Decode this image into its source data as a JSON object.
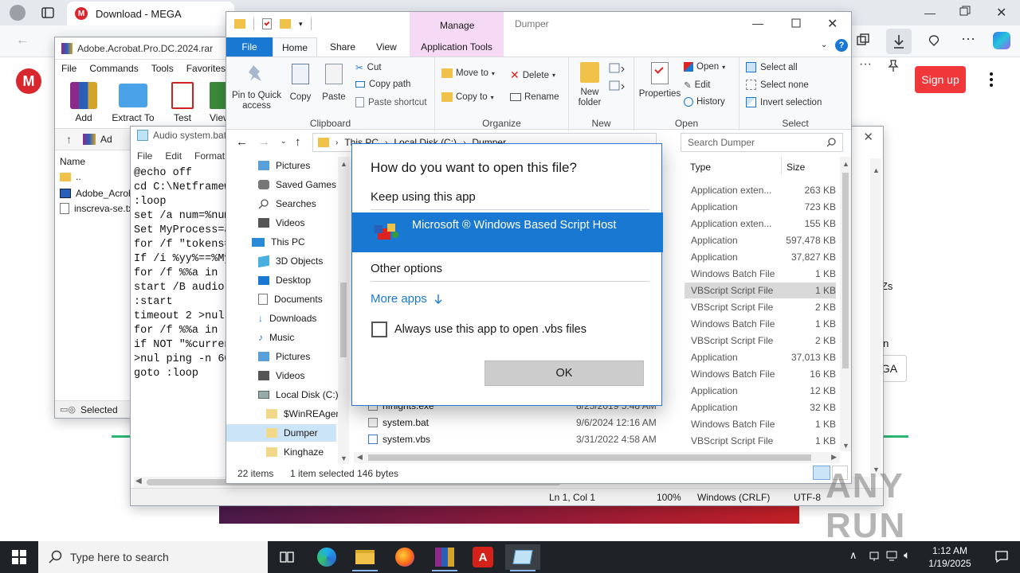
{
  "browser": {
    "tab_title": "Download - MEGA",
    "signup_label": "Sign up",
    "ga_label": "GA",
    "edge_text_1": "TZs",
    "edge_text_2": "nin"
  },
  "winrar": {
    "title": "Adobe.Acrobat.Pro.DC.2024.rar",
    "menu": [
      "File",
      "Commands",
      "Tools",
      "Favorites"
    ],
    "toolbar": [
      "Add",
      "Extract To",
      "Test",
      "View"
    ],
    "path_stub": "Ad",
    "col_name": "Name",
    "files": [
      "..",
      "Adobe_Acrob",
      "inscreva-se.tx"
    ],
    "status": "Selected"
  },
  "notepad": {
    "title": "Audio system.bat",
    "menu": [
      "File",
      "Edit",
      "Format"
    ],
    "lines": [
      "@echo off",
      "cd C:\\Netframew",
      ":loop",
      "set /a num=%num",
      "Set MyProcess=a",
      "for /f \"tokens=",
      "If /i %yy%==%My",
      "for /f %%a in ",
      "start /B audio.",
      ":start",
      "timeout 2 >nul",
      "for /f %%a in ",
      "if NOT \"%curren",
      ">nul ping -n 60",
      "goto :loop"
    ],
    "status": {
      "position": "Ln 1, Col 1",
      "zoom": "100%",
      "eol": "Windows (CRLF)",
      "encoding": "UTF-8"
    }
  },
  "explorer": {
    "title": "Dumper",
    "tabs": [
      "File",
      "Home",
      "Share",
      "View"
    ],
    "manage_label": "Manage",
    "app_tools_label": "Application Tools",
    "clipboard": {
      "pin": "Pin to Quick access",
      "copy": "Copy",
      "paste": "Paste",
      "cut": "Cut",
      "copy_path": "Copy path",
      "paste_shortcut": "Paste shortcut",
      "label": "Clipboard"
    },
    "organize": {
      "move_to": "Move to",
      "copy_to": "Copy to",
      "delete": "Delete",
      "rename": "Rename",
      "label": "Organize"
    },
    "new": {
      "new_folder": "New folder",
      "label": "New"
    },
    "open": {
      "properties": "Properties",
      "open": "Open",
      "edit": "Edit",
      "history": "History",
      "label": "Open"
    },
    "select": {
      "select_all": "Select all",
      "select_none": "Select none",
      "invert": "Invert selection",
      "label": "Select"
    },
    "breadcrumb": [
      "This PC",
      "Local Disk (C:)",
      "Dumper"
    ],
    "search_placeholder": "Search Dumper",
    "nav": [
      "Pictures",
      "Saved Games",
      "Searches",
      "Videos",
      "This PC",
      "3D Objects",
      "Desktop",
      "Documents",
      "Downloads",
      "Music",
      "Pictures",
      "Videos",
      "Local Disk (C:)",
      "$WinREAgent",
      "Dumper",
      "Kinghaze"
    ],
    "col_type": "Type",
    "col_size": "Size",
    "rows": [
      {
        "type": "Application exten...",
        "size": "263 KB"
      },
      {
        "type": "Application",
        "size": "723 KB"
      },
      {
        "type": "Application exten...",
        "size": "155 KB"
      },
      {
        "type": "Application",
        "size": "597,478 KB"
      },
      {
        "type": "Application",
        "size": "37,827 KB"
      },
      {
        "type": "Windows Batch File",
        "size": "1 KB"
      },
      {
        "type": "VBScript Script File",
        "size": "1 KB"
      },
      {
        "type": "VBScript Script File",
        "size": "2 KB"
      },
      {
        "type": "Windows Batch File",
        "size": "1 KB"
      },
      {
        "type": "VBScript Script File",
        "size": "2 KB"
      },
      {
        "type": "Application",
        "size": "37,013 KB"
      },
      {
        "type": "Windows Batch File",
        "size": "16 KB"
      },
      {
        "type": "Application",
        "size": "12 KB"
      },
      {
        "type": "Application",
        "size": "32 KB"
      },
      {
        "type": "Windows Batch File",
        "size": "1 KB"
      },
      {
        "type": "VBScript Script File",
        "size": "1 KB"
      }
    ],
    "bottom_files": [
      {
        "name": "nfnights.exe",
        "date": "8/25/2019 5:48 AM"
      },
      {
        "name": "system.bat",
        "date": "9/6/2024 12:16 AM"
      },
      {
        "name": "system.vbs",
        "date": "3/31/2022 4:58 AM"
      }
    ],
    "status": {
      "count": "22 items",
      "selected": "1 item selected",
      "size": "146 bytes"
    }
  },
  "dialog": {
    "title": "How do you want to open this file?",
    "keep_using": "Keep using this app",
    "app_name": "Microsoft ® Windows Based Script Host",
    "other_options": "Other options",
    "more_apps": "More apps",
    "always_use": "Always use this app to open .vbs files",
    "ok": "OK"
  },
  "taskbar": {
    "search_placeholder": "Type here to search",
    "time": "1:12 AM",
    "date": "1/19/2025"
  },
  "watermark": "ANY RUN",
  "colors": {
    "accent": "#1979d2",
    "mega_red": "#d9272e",
    "taskbar": "#1f2328"
  }
}
